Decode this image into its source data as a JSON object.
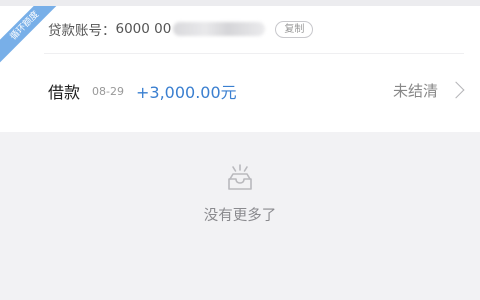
{
  "card": {
    "ribbon_label": "循环额度",
    "account_label": "贷款账号：",
    "account_number_visible": "6000 00",
    "copy_label": "复制"
  },
  "loan": {
    "type": "借款",
    "date": "08-29",
    "amount": "+3,000.00元",
    "status": "未结清"
  },
  "empty_state": {
    "icon": "empty-tray-icon",
    "message": "没有更多了"
  },
  "colors": {
    "accent": "#3a7fd0",
    "ribbon": "#6aa7e6",
    "background": "#f2f2f4"
  }
}
